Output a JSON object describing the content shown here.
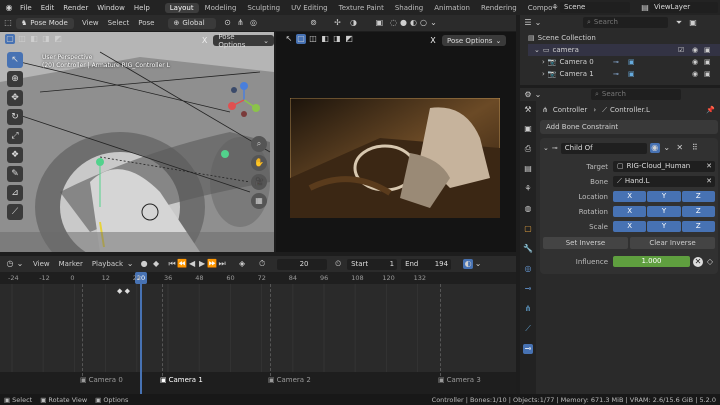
{
  "topbar": {
    "menus": [
      "File",
      "Edit",
      "Render",
      "Window",
      "Help"
    ],
    "workspaces": [
      "Layout",
      "Modeling",
      "Sculpting",
      "UV Editing",
      "Texture Paint",
      "Shading",
      "Animation",
      "Rendering",
      "Compo"
    ],
    "active_workspace": "Layout",
    "scene": "Scene",
    "view_layer": "ViewLayer"
  },
  "viewport_left": {
    "mode": "Pose Mode",
    "menus": [
      "View",
      "Select",
      "Pose"
    ],
    "transform": "Global",
    "overlay_line1": "User Perspective",
    "overlay_line2": "(20) Controller | Armature RIG_Controller L",
    "options": "Pose Options"
  },
  "viewport_right": {
    "options": "Pose Options"
  },
  "timeline": {
    "menus": [
      "View",
      "Marker",
      "Playback"
    ],
    "current_frame": "20",
    "start_label": "Start",
    "start": "1",
    "end_label": "End",
    "end": "194",
    "ticks": [
      "-24",
      "-12",
      "0",
      "12",
      "24",
      "36",
      "48",
      "60",
      "72",
      "84",
      "96",
      "108",
      "120",
      "132"
    ],
    "playhead": "20",
    "markers": [
      "Camera 0",
      "Camera 1",
      "Camera 2",
      "Camera 3"
    ]
  },
  "outliner": {
    "search_placeholder": "Search",
    "root": "Scene Collection",
    "collection": "camera",
    "items": [
      "Camera 0",
      "Camera 1"
    ]
  },
  "props": {
    "search_placeholder": "Search",
    "breadcrumb_object": "Controller",
    "breadcrumb_bone": "Controller.L",
    "add_constraint": "Add Bone Constraint",
    "constraint_name": "Child Of",
    "target_label": "Target",
    "target_value": "RIG-Cloud_Human",
    "bone_label": "Bone",
    "bone_value": "Hand.L",
    "location_label": "Location",
    "rotation_label": "Rotation",
    "scale_label": "Scale",
    "x": "X",
    "y": "Y",
    "z": "Z",
    "set_inverse": "Set Inverse",
    "clear_inverse": "Clear Inverse",
    "influence_label": "Influence",
    "influence_value": "1.000",
    "influence_fraction": 1.0
  },
  "statusbar": {
    "select": "Select",
    "rotate": "Rotate View",
    "options": "Options",
    "info": "Controller | Bones:1/10 | Objects:1/77 | Memory: 671.3 MiB | VRAM: 2.6/15.6 GiB | 5.2.0"
  },
  "colors": {
    "accent": "#4772b3",
    "influence": "#5f9f3f",
    "playhead": "#4772b3"
  }
}
